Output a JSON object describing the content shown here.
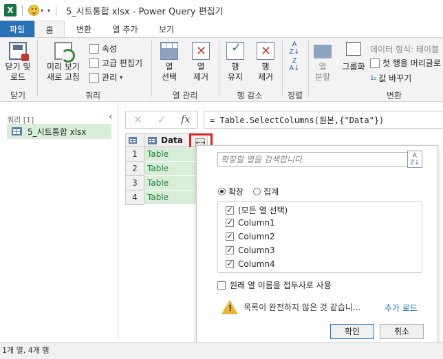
{
  "window": {
    "title": "5_시트통합 xlsx - Power Query 편집기",
    "app_icon": "X"
  },
  "tabs": [
    {
      "label": "파일"
    },
    {
      "label": "홈"
    },
    {
      "label": "변환"
    },
    {
      "label": "열 추가"
    },
    {
      "label": "보기"
    }
  ],
  "ribbon": {
    "close_load": "닫기 및\n로드",
    "close_group": "닫기",
    "refresh": "미리 보기\n새로 고침",
    "properties": "속성",
    "advanced_editor": "고급 편집기",
    "manage": "관리",
    "query_group": "쿼리",
    "choose_columns": "열\n선택",
    "remove_columns": "열\n제거",
    "column_mgmt_group": "열 관리",
    "keep_rows": "행\n유지",
    "remove_rows": "행\n제거",
    "row_reduce_group": "행 감소",
    "sort_group": "정렬",
    "split_column": "열\n분할",
    "group_by": "그룹화",
    "data_type": "데이터 형식: 테이블",
    "first_row_header": "첫 행을 머리글로",
    "replace_values": "값 바꾸기",
    "transform_group": "변환"
  },
  "queries": {
    "title": "쿼리 [1]",
    "items": [
      {
        "label": "5_시트통합 xlsx"
      }
    ]
  },
  "formula": {
    "text": "= Table.SelectColumns(원본,{\"Data\"})",
    "fx": "fx"
  },
  "grid": {
    "column_header": "Data",
    "rows": [
      {
        "num": "1",
        "value": "Table"
      },
      {
        "num": "2",
        "value": "Table"
      },
      {
        "num": "3",
        "value": "Table"
      },
      {
        "num": "4",
        "value": "Table"
      }
    ]
  },
  "expand_popup": {
    "search_placeholder": "확장할 열을 검색합니다.",
    "radio_expand": "확장",
    "radio_aggregate": "집계",
    "columns": [
      {
        "label": "(모든 열 선택)",
        "checked": true
      },
      {
        "label": "Column1",
        "checked": true
      },
      {
        "label": "Column2",
        "checked": true
      },
      {
        "label": "Column3",
        "checked": true
      },
      {
        "label": "Column4",
        "checked": true
      }
    ],
    "prefix_label": "원래 열 이름을 접두사로 사용",
    "warning": "목록이 완전하지 않은 것 같습니...",
    "load_more": "추가 로드",
    "ok": "확인",
    "cancel": "취소"
  },
  "status": "1개 열, 4개 행",
  "colors": {
    "file_tab": "#2a72b8",
    "selected_green": "#d9eed9",
    "table_link": "#1a7a3a",
    "highlight_red": "#e02020",
    "link_blue": "#1f6fc2"
  }
}
